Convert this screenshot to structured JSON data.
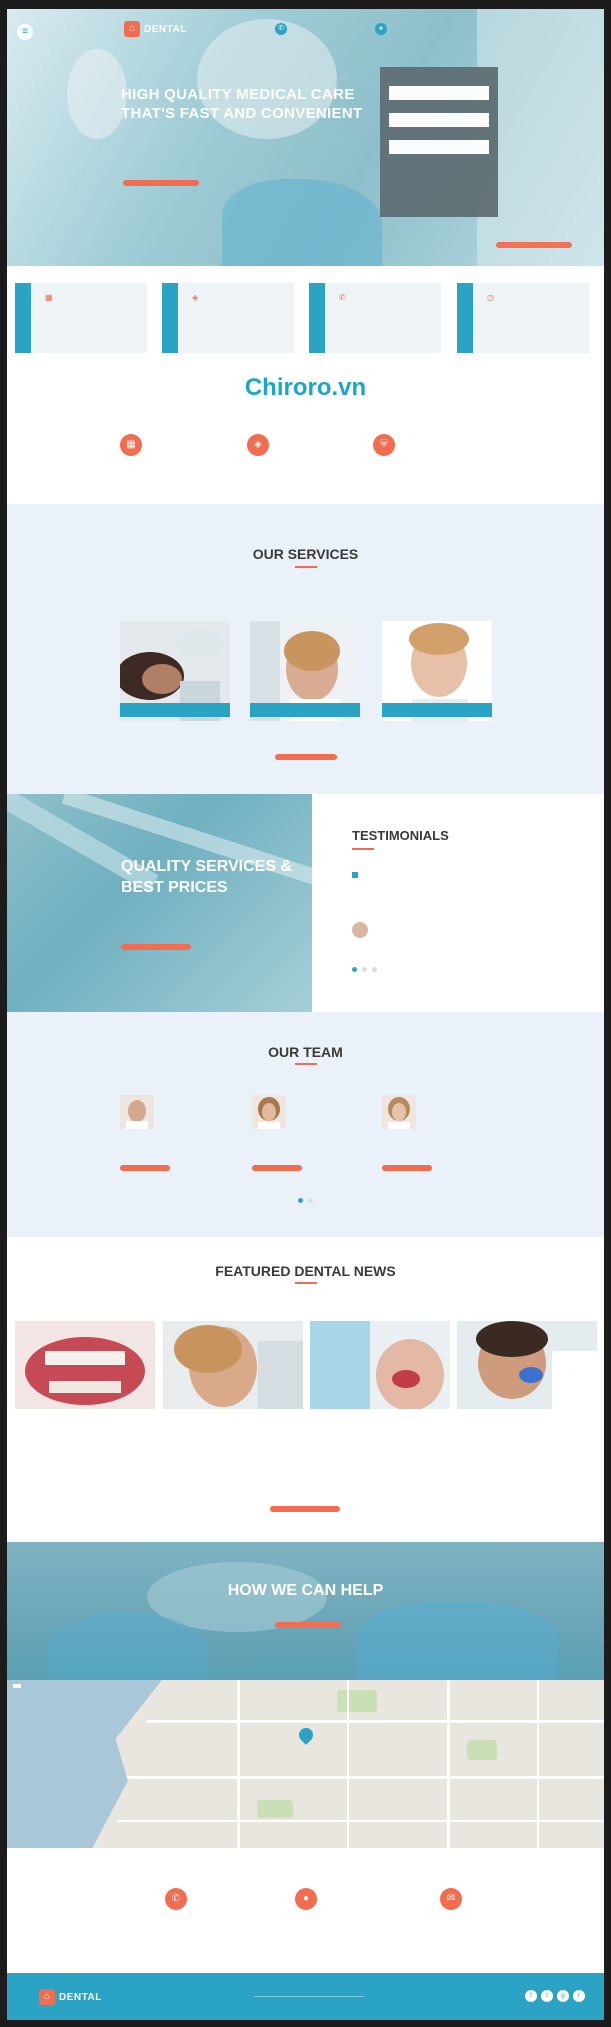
{
  "header": {
    "logo_text": "DENTAL",
    "menu_icon": "menu-icon",
    "contact_1": "",
    "contact_2": ""
  },
  "hero": {
    "title": "HIGH QUALITY MEDICAL CARE THAT'S FAST AND CONVENIENT",
    "text": "",
    "button": "",
    "form": {
      "title": "",
      "field_1_placeholder": "",
      "field_2_placeholder": "",
      "field_3_placeholder": "",
      "submit": ""
    }
  },
  "info_boxes": [
    {
      "side": "",
      "icon": "calendar-icon"
    },
    {
      "side": "",
      "icon": "tooth-icon"
    },
    {
      "side": "",
      "icon": "phone-icon"
    },
    {
      "side": "",
      "icon": "clock-icon"
    }
  ],
  "watermark": "Chiroro.vn",
  "features": [
    {
      "icon": "calendar-icon",
      "title": "",
      "desc": ""
    },
    {
      "icon": "tooth-icon",
      "title": "",
      "desc": ""
    },
    {
      "icon": "shield-icon",
      "title": "",
      "desc": ""
    }
  ],
  "services": {
    "title": "OUR SERVICES",
    "subtitle": "",
    "items": [
      {
        "label": ""
      },
      {
        "label": ""
      },
      {
        "label": ""
      }
    ],
    "button": ""
  },
  "quality": {
    "title": "QUALITY SERVICES & BEST PRICES",
    "text": "",
    "button": ""
  },
  "testimonials": {
    "title": "TESTIMONIALS",
    "text": "",
    "name": "",
    "role": ""
  },
  "team": {
    "title": "OUR TEAM",
    "members": [
      {
        "name": "",
        "role": "",
        "phone": "",
        "desc": "",
        "button": ""
      },
      {
        "name": "",
        "role": "",
        "phone": "",
        "desc": "",
        "button": ""
      },
      {
        "name": "",
        "role": "",
        "phone": "",
        "desc": "",
        "button": ""
      }
    ]
  },
  "news": {
    "title": "FEATURED DENTAL NEWS",
    "articles": [
      {
        "title": "",
        "text": "",
        "meta": ""
      },
      {
        "title": "",
        "text": "",
        "meta": ""
      },
      {
        "title": "",
        "text": "",
        "meta": ""
      },
      {
        "title": "",
        "text": "",
        "meta": ""
      }
    ],
    "button": ""
  },
  "help": {
    "title": "HOW WE CAN HELP",
    "subtitle": "",
    "button": ""
  },
  "map": {
    "control": ""
  },
  "contacts": [
    {
      "icon": "phone-icon",
      "text": ""
    },
    {
      "icon": "location-icon",
      "text": ""
    },
    {
      "icon": "mail-icon",
      "text": ""
    }
  ],
  "footer": {
    "logo_text": "DENTAL",
    "socials": [
      "facebook-icon",
      "twitter-icon",
      "google-plus-icon",
      "rss-icon"
    ]
  },
  "colors": {
    "accent": "#f26c4f",
    "brand": "#2ba3c4",
    "section_bg": "#eaf1f8"
  }
}
